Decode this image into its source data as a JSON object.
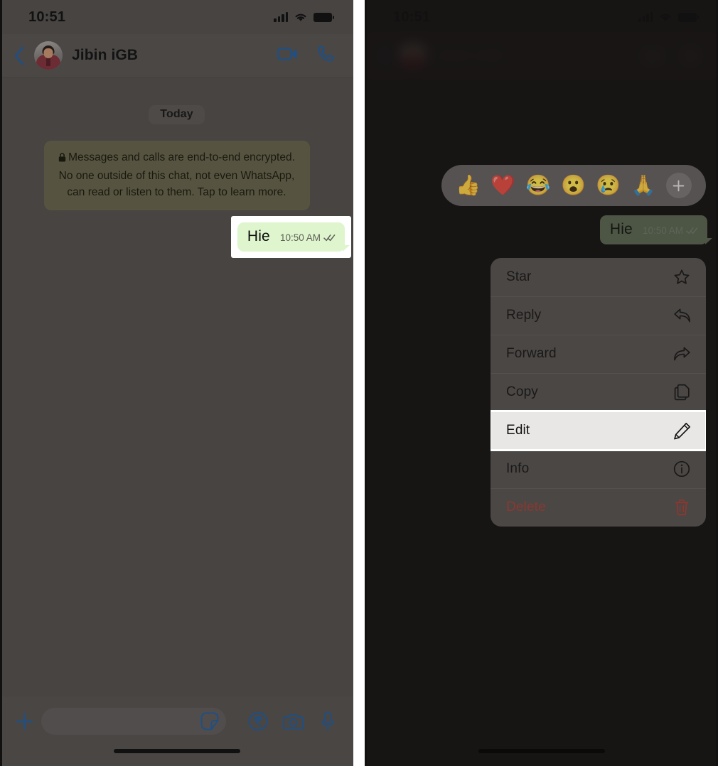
{
  "left_panel": {
    "status_bar": {
      "time": "10:51",
      "signal_icon": "cellular-bars-icon",
      "wifi_icon": "wifi-icon",
      "battery_icon": "battery-full-icon"
    },
    "header": {
      "back_icon": "back-chevron-icon",
      "avatar": "contact-avatar",
      "contact_name": "Jibin iGB",
      "video_call_icon": "video-call-icon",
      "voice_call_icon": "phone-call-icon"
    },
    "chat": {
      "day_divider": "Today",
      "encryption_notice": "Messages and calls are end-to-end encrypted. No one outside of this chat, not even WhatsApp, can read or listen to them. Tap to learn more.",
      "lock_icon": "lock-icon",
      "messages": [
        {
          "text": "Hie",
          "time": "10:50 AM",
          "status_icon": "double-check-read-icon",
          "outgoing": true,
          "highlighted": true
        }
      ]
    },
    "input_bar": {
      "plus_icon": "plus-attach-icon",
      "input_value": "",
      "input_placeholder": "",
      "sticker_icon": "sticker-icon",
      "payment_icon": "rupee-payment-icon",
      "camera_icon": "camera-icon",
      "mic_icon": "microphone-icon"
    }
  },
  "right_panel": {
    "status_bar": {
      "time": "10:51",
      "signal_icon": "cellular-bars-icon",
      "wifi_icon": "wifi-icon",
      "battery_icon": "battery-full-icon"
    },
    "reaction_bar": {
      "emojis": [
        "👍",
        "❤️",
        "😂",
        "😮",
        "😢",
        "🙏"
      ],
      "emoji_names": [
        "thumbs-up-emoji",
        "red-heart-emoji",
        "face-with-tears-of-joy-emoji",
        "face-with-open-mouth-emoji",
        "crying-face-emoji",
        "folded-hands-emoji"
      ],
      "more_icon": "add-reaction-plus-icon"
    },
    "selected_message": {
      "text": "Hie",
      "time": "10:50 AM",
      "status_icon": "double-check-read-icon"
    },
    "context_menu": {
      "items": [
        {
          "label": "Star",
          "icon": "star-icon",
          "destructive": false,
          "highlighted": false
        },
        {
          "label": "Reply",
          "icon": "reply-icon",
          "destructive": false,
          "highlighted": false
        },
        {
          "label": "Forward",
          "icon": "forward-icon",
          "destructive": false,
          "highlighted": false
        },
        {
          "label": "Copy",
          "icon": "copy-icon",
          "destructive": false,
          "highlighted": false
        },
        {
          "label": "Edit",
          "icon": "pencil-edit-icon",
          "destructive": false,
          "highlighted": true
        },
        {
          "label": "Info",
          "icon": "info-icon",
          "destructive": false,
          "highlighted": false
        },
        {
          "label": "Delete",
          "icon": "trash-delete-icon",
          "destructive": true,
          "highlighted": false
        }
      ]
    }
  },
  "colors": {
    "chat_background": "#474442",
    "dimmed_background": "#2b2826",
    "outgoing_bubble": "#dff5cd",
    "encryption_bubble": "#565440",
    "menu_background": "#4a4745",
    "highlight_row": "#e9e7e5",
    "highlight_border": "#ffffff",
    "destructive_text": "#8e372f",
    "accent_blue": "#1f4f84"
  }
}
